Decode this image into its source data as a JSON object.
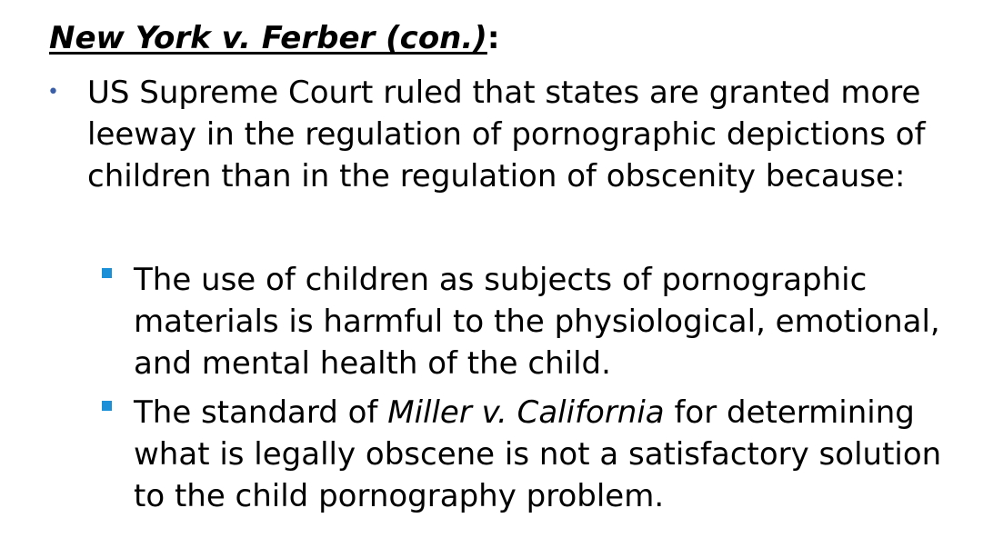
{
  "slide": {
    "title": {
      "main": "New York v. Ferber (con.)",
      "colon": ":"
    },
    "bullet": {
      "text": "US Supreme Court ruled that states are granted more leeway in the regulation of pornographic depictions of children than in the regulation of obscenity because:"
    },
    "sub_bullets": [
      {
        "text": "The use of children as subjects of pornographic materials is harmful to the physiological, emotional, and mental health of the child."
      },
      {
        "text_before": "The standard of ",
        "text_italic": "Miller v. California",
        "text_after": " for determining what is legally obscene is not a satisfactory solution to the child pornography problem."
      }
    ],
    "colors": {
      "bullet_l1": "#3a5fa8",
      "bullet_l2": "#1a90d8",
      "text": "#000000"
    },
    "icons": {
      "bullet_l1": "round-bullet-icon",
      "bullet_l2": "square-bullet-icon"
    }
  }
}
